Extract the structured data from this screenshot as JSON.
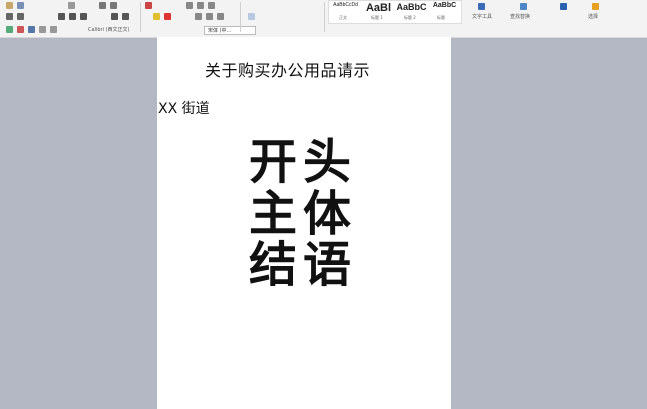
{
  "ribbon": {
    "font_family_box": "宋体 (中...",
    "font_name_left": "Calibri (西文正文)",
    "styles": [
      {
        "sample": "AaBbCcDd",
        "name": "正文"
      },
      {
        "sample": "AaBl",
        "name": "标题 1"
      },
      {
        "sample": "AaBbC",
        "name": "标题 2"
      },
      {
        "sample": "AaBbC",
        "name": "标题"
      }
    ],
    "find_label": "查找替换",
    "select_label": "选择",
    "text_tool_label": "文字工具"
  },
  "document": {
    "title": "关于购买办公用品请示",
    "salutation": "XX 街道",
    "sections": [
      "开头",
      "主体",
      "结语"
    ]
  }
}
